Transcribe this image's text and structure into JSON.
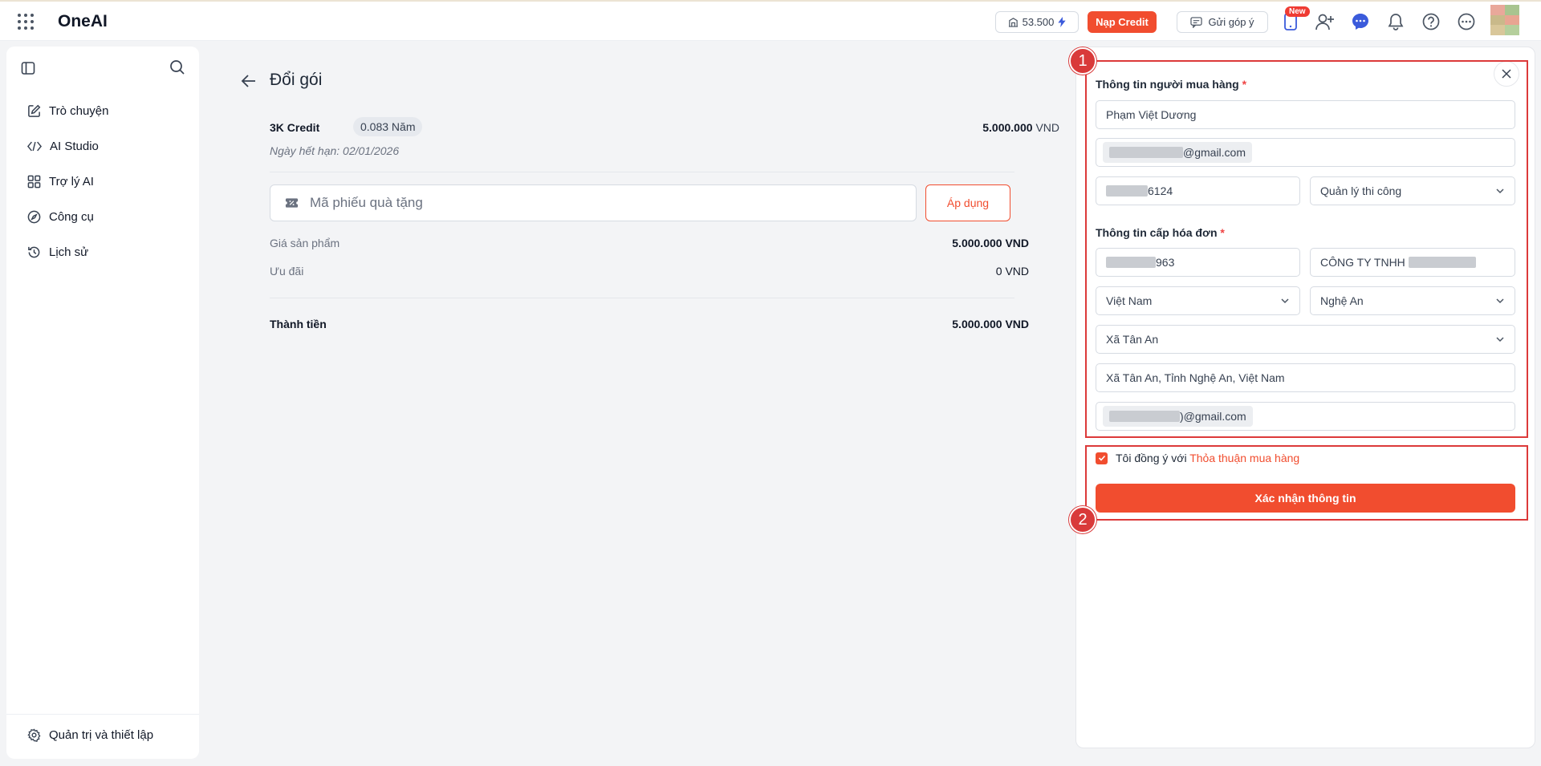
{
  "header": {
    "brand": "OneAI",
    "credit_balance": "53.500",
    "topup_label": "Nạp Credit",
    "feedback_label": "Gửi góp ý",
    "new_badge": "New"
  },
  "sidebar": {
    "items": [
      {
        "label": "Trò chuyện",
        "icon": "edit-icon"
      },
      {
        "label": "AI Studio",
        "icon": "code-icon"
      },
      {
        "label": "Trợ lý AI",
        "icon": "grid-icon"
      },
      {
        "label": "Công cụ",
        "icon": "compass-icon"
      },
      {
        "label": "Lịch sử",
        "icon": "history-icon"
      }
    ],
    "settings_label": "Quản trị và thiết lập"
  },
  "main": {
    "title": "Đổi gói",
    "package": {
      "name": "3K Credit",
      "duration": "0.083 Năm",
      "price": "5.000.000",
      "currency": "VND",
      "expiry": "Ngày hết hạn: 02/01/2026"
    },
    "voucher_placeholder": "Mã phiếu quà tặng",
    "apply_label": "Áp dụng",
    "product_price_label": "Giá sản phẩm",
    "product_price_value": "5.000.000 VND",
    "discount_label": "Ưu đãi",
    "discount_value": "0 VND",
    "total_label": "Thành tiền",
    "total_value": "5.000.000 VND"
  },
  "panel": {
    "buyer_title": "Thông tin người mua hàng",
    "required_mark": "*",
    "buyer_name": "Phạm Việt Dương",
    "buyer_email_suffix": "@gmail.com",
    "buyer_phone_suffix": "6124",
    "buyer_role": "Quản lý thi công",
    "invoice_title": "Thông tin cấp hóa đơn",
    "tax_code_suffix": "963",
    "company_prefix": "CÔNG TY TNHH",
    "country": "Việt Nam",
    "province": "Nghệ An",
    "ward": "Xã Tân An",
    "address": "Xã Tân An, Tỉnh Nghệ An, Việt Nam",
    "invoice_email_suffix": ")@gmail.com",
    "agree_prefix": "Tôi đồng ý với",
    "agree_link": "Thỏa thuận mua hàng",
    "confirm_label": "Xác nhận thông tin",
    "annotation_1": "1",
    "annotation_2": "2"
  },
  "colors": {
    "accent": "#f14d2f",
    "annotation": "#d93a3a"
  }
}
